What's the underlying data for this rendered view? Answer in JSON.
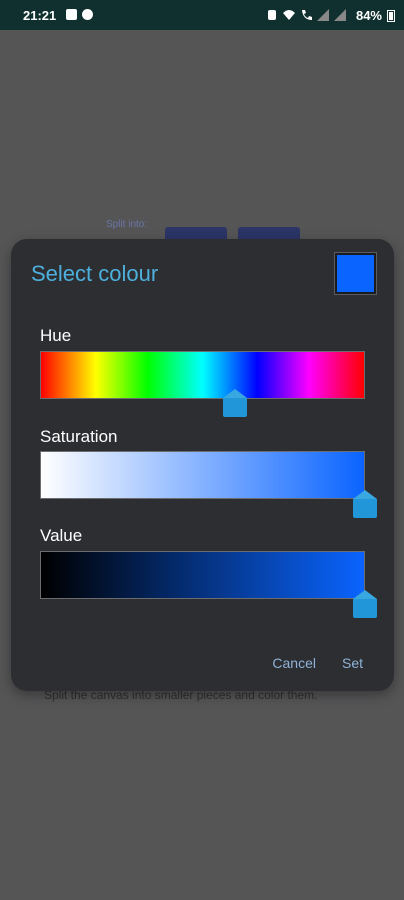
{
  "status_bar": {
    "time": "21:21",
    "battery": "84%"
  },
  "background": {
    "split_label": "Split into:",
    "description": "Split the canvas into smaller pieces and color them."
  },
  "dialog": {
    "title": "Select colour",
    "preview_color": "#0a64ff",
    "sliders": {
      "hue": {
        "label": "Hue",
        "value": 0.6
      },
      "saturation": {
        "label": "Saturation",
        "value": 1.0
      },
      "value": {
        "label": "Value",
        "value": 1.0
      }
    },
    "cancel_label": "Cancel",
    "set_label": "Set"
  }
}
